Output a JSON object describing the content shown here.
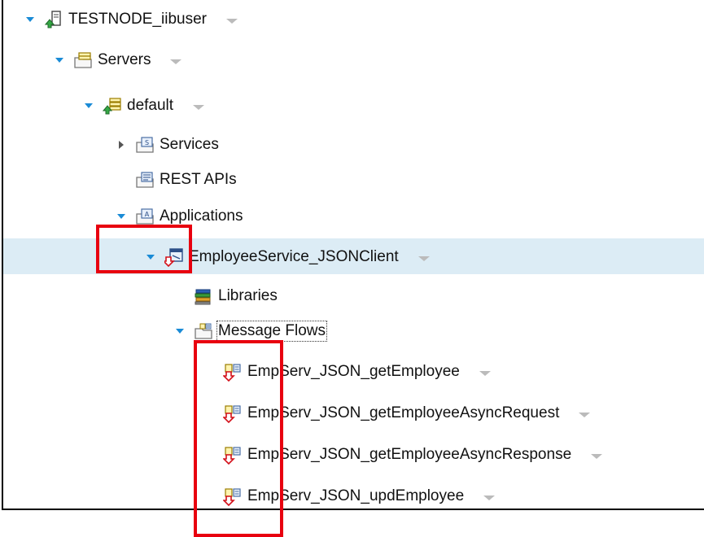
{
  "tree": {
    "items": [
      {
        "label": "TESTNODE_iibuser",
        "icon": "integration-node-icon",
        "expander": "expanded",
        "menu": true,
        "selected": false,
        "focused": false
      },
      {
        "label": "Servers",
        "icon": "servers-folder-icon",
        "expander": "expanded",
        "menu": true,
        "selected": false,
        "focused": false
      },
      {
        "label": "default",
        "icon": "integration-server-icon",
        "expander": "expanded",
        "menu": true,
        "selected": false,
        "focused": false
      },
      {
        "label": "Services",
        "icon": "services-folder-icon",
        "expander": "collapsed",
        "menu": false,
        "selected": false,
        "focused": false
      },
      {
        "label": "REST APIs",
        "icon": "rest-apis-folder-icon",
        "expander": "none",
        "menu": false,
        "selected": false,
        "focused": false
      },
      {
        "label": "Applications",
        "icon": "applications-folder-icon",
        "expander": "expanded",
        "menu": false,
        "selected": false,
        "focused": false
      },
      {
        "label": "EmployeeService_JSONClient",
        "icon": "application-icon",
        "expander": "expanded",
        "menu": true,
        "selected": true,
        "focused": false
      },
      {
        "label": "Libraries",
        "icon": "libraries-icon",
        "expander": "none",
        "menu": false,
        "selected": false,
        "focused": false
      },
      {
        "label": "Message Flows",
        "icon": "message-flows-folder-icon",
        "expander": "expanded",
        "menu": false,
        "selected": false,
        "focused": true
      },
      {
        "label": "EmpServ_JSON_getEmployee",
        "icon": "message-flow-icon",
        "expander": "none",
        "menu": true,
        "selected": false,
        "focused": false
      },
      {
        "label": "EmpServ_JSON_getEmployeeAsyncRequest",
        "icon": "message-flow-icon",
        "expander": "none",
        "menu": true,
        "selected": false,
        "focused": false
      },
      {
        "label": "EmpServ_JSON_getEmployeeAsyncResponse",
        "icon": "message-flow-icon",
        "expander": "none",
        "menu": true,
        "selected": false,
        "focused": false
      },
      {
        "label": "EmpServ_JSON_updEmployee",
        "icon": "message-flow-icon",
        "expander": "none",
        "menu": true,
        "selected": false,
        "focused": false
      }
    ]
  },
  "colors": {
    "selection": "#dcecf5",
    "expander": "#1a8bd6",
    "highlight_box": "#e8000f"
  }
}
